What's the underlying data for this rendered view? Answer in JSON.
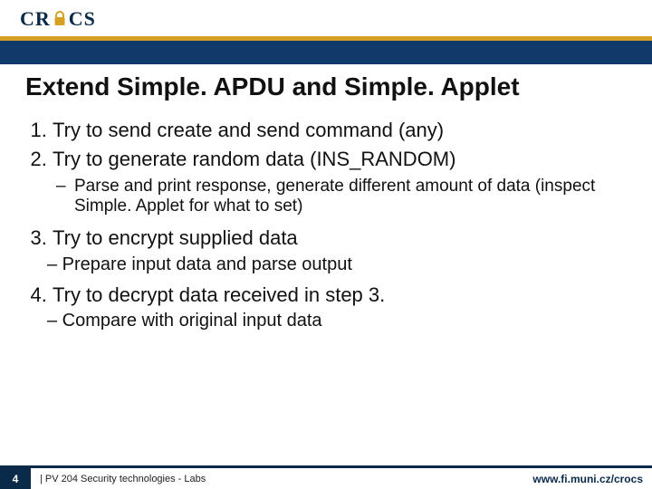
{
  "brand": {
    "name_pre": "CR",
    "name_post": "CS",
    "colors": {
      "blue": "#113a6b",
      "gold": "#d6a022",
      "dark": "#0a2a4a"
    }
  },
  "title": "Extend Simple. APDU and Simple. Applet",
  "items": {
    "i1": "Try to send create and send command (any)",
    "i2": "Try to generate random data (INS_RANDOM)",
    "i2_sub": "Parse and print response, generate different amount of data (inspect Simple. Applet for what to set)",
    "i3": "Try to encrypt supplied data",
    "i3_sub": "– Prepare input data and parse output",
    "i4": "Try to decrypt data received in step 3.",
    "i4_sub": "– Compare with original input data"
  },
  "footer": {
    "page": "4",
    "text": "| PV 204 Security technologies - Labs",
    "url": "www.fi.muni.cz/crocs"
  }
}
